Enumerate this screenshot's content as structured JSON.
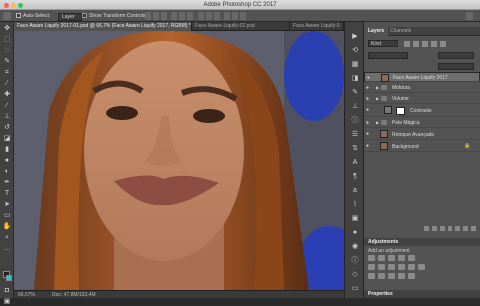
{
  "window": {
    "title": "Adobe Photoshop CC 2017"
  },
  "options_bar": {
    "auto_select_label": "Auto-Select:",
    "auto_select_value": "Layer",
    "transform_controls_label": "Show Transform Controls"
  },
  "document_tabs": [
    {
      "label": "Face Aware Liquify 2017-01.psd @ 66,7% (Face Aware Liquify 2017, RGB/8) *"
    },
    {
      "label": "Face-Aware-Liquify-02.psd"
    },
    {
      "label": "Face Aware Liquify-0"
    }
  ],
  "status_bar": {
    "zoom": "66,67%",
    "doc": "Doc: 47,8M/163,4M"
  },
  "layers_panel": {
    "tabs": [
      "Layers",
      "Channels"
    ],
    "kind": "Kind",
    "blend": "Normal",
    "layers": [
      {
        "name": "Face Aware Liquify 2017",
        "selected": true,
        "type": "image"
      },
      {
        "name": "Moldura",
        "type": "group"
      },
      {
        "name": "Volume",
        "type": "group"
      },
      {
        "name": "Contraste",
        "type": "adjustment"
      },
      {
        "name": "Pele Mágica",
        "type": "group"
      },
      {
        "name": "Retoque Avançado",
        "type": "image"
      },
      {
        "name": "Background",
        "type": "image",
        "locked": true
      }
    ]
  },
  "adjustments_panel": {
    "title": "Adjustments",
    "subtitle": "Add an adjustment"
  },
  "properties_panel": {
    "title": "Properties"
  },
  "colors": {
    "fg": "#222222",
    "bg": "#2ec4d6",
    "accent": "#2c7dd6"
  }
}
